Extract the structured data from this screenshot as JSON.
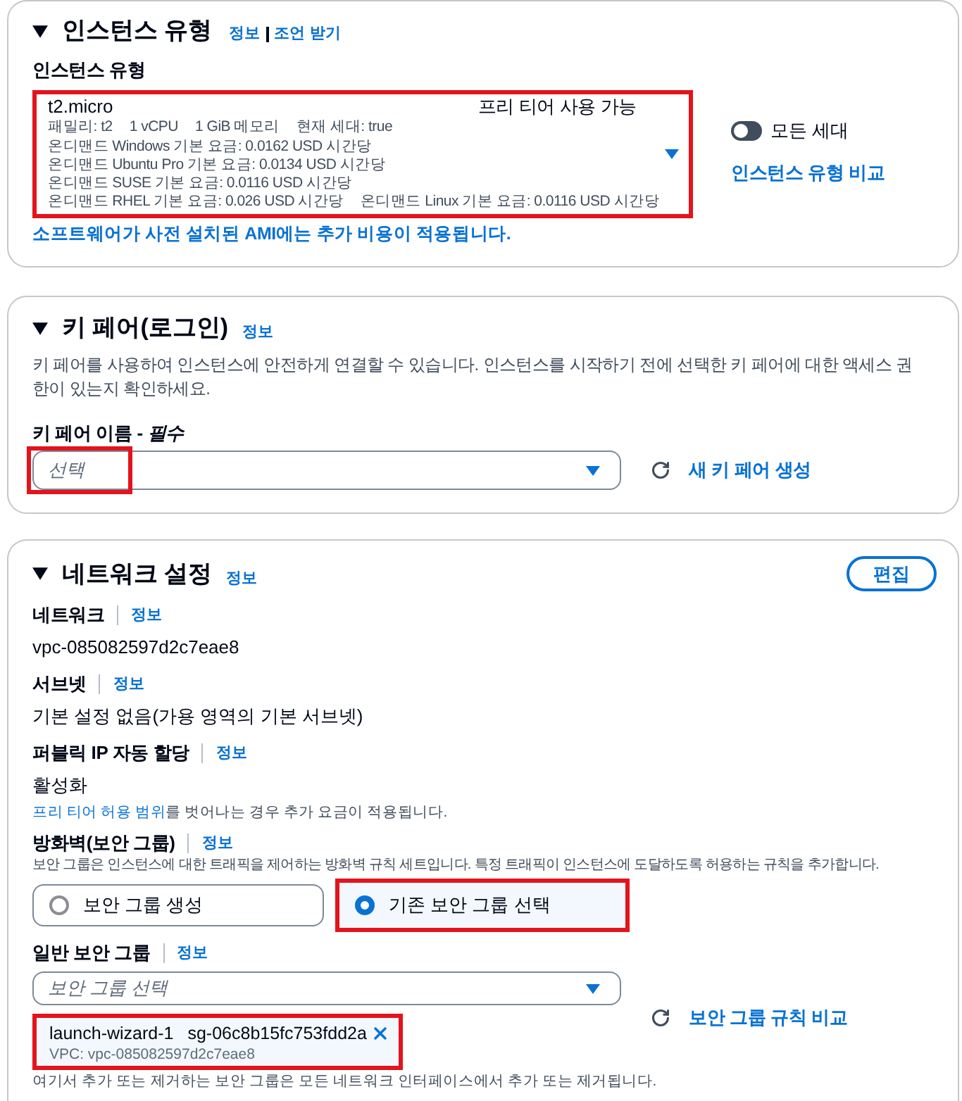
{
  "instance_type": {
    "title": "인스턴스 유형",
    "expanded": true,
    "links": [
      "정보",
      "조언 받기"
    ],
    "field_label": "인스턴스 유형",
    "select": {
      "value": "t2.micro",
      "badge": "프리 티어 사용 가능",
      "details": [
        [
          "패밀리: t2",
          "1 vCPU",
          "1 GiB 메모리",
          "현재 세대: true"
        ],
        [
          "온디맨드 Windows 기본 요금: 0.0162 USD 시간당"
        ],
        [
          "온디맨드 Ubuntu Pro 기본 요금: 0.0134 USD 시간당"
        ],
        [
          "온디맨드 SUSE 기본 요금: 0.0116 USD 시간당"
        ],
        [
          "온디맨드 RHEL 기본 요금: 0.026 USD 시간당",
          "온디맨드 Linux 기본 요금: 0.0116 USD 시간당"
        ]
      ],
      "highlighted": true
    },
    "toggle": {
      "label": "모든 세대",
      "on": false
    },
    "compare_link": "인스턴스 유형 비교",
    "note": "소프트웨어가 사전 설치된 AMI에는 추가 비용이 적용됩니다."
  },
  "key_pair": {
    "title": "키 페어(로그인)",
    "expanded": true,
    "info": "정보",
    "description": "키 페어를 사용하여 인스턴스에 안전하게 연결할 수 있습니다. 인스턴스를 시작하기 전에 선택한 키 페어에 대한 액세스 권한이 있는지 확인하세요.",
    "field_label": "키 페어 이름 - *필수*",
    "select": {
      "placeholder": "선택",
      "highlighted": true
    },
    "create_link": "새 키 페어 생성"
  },
  "network": {
    "title": "네트워크 설정",
    "expanded": true,
    "info": "정보",
    "edit_button": "편집",
    "fields": [
      {
        "label": "네트워크",
        "info": "정보",
        "value": "vpc-085082597d2c7eae8"
      },
      {
        "label": "서브넷",
        "info": "정보",
        "value": "기본 설정 없음(가용 영역의 기본 서브넷)"
      },
      {
        "label": "퍼블릭 IP 자동 할당",
        "info": "정보",
        "value": "활성화",
        "note": {
          "link": "프리 티어 허용 범위",
          "text": "를 벗어나는 경우 추가 요금이 적용됩니다."
        }
      }
    ],
    "firewall": {
      "label": "방화벽(보안 그룹)",
      "info": "정보",
      "description": "보안 그룹은 인스턴스에 대한 트래픽을 제어하는 방화벽 규칙 세트입니다. 특정 트래픽이 인스턴스에 도달하도록 허용하는 규칙을 추가합니다.",
      "options": [
        {
          "label": "보안 그룹 생성",
          "selected": false,
          "highlighted": false
        },
        {
          "label": "기존 보안 그룹 선택",
          "selected": true,
          "highlighted": true
        }
      ]
    },
    "security_groups": {
      "label": "일반 보안 그룹",
      "info": "정보",
      "select": {
        "placeholder": "보안 그룹 선택"
      },
      "tokens": [
        {
          "name": "launch-wizard-1",
          "group_id": "sg-06c8b15fc753fdd2a",
          "vpc": "VPC: vpc-085082597d2c7eae8",
          "highlighted": true
        }
      ],
      "compare_link": "보안 그룹 규칙 비교",
      "footnote": "여기서 추가 또는 제거하는 보안 그룹은 모든 네트워크 인터페이스에서 추가 또는 제거됩니다."
    }
  }
}
